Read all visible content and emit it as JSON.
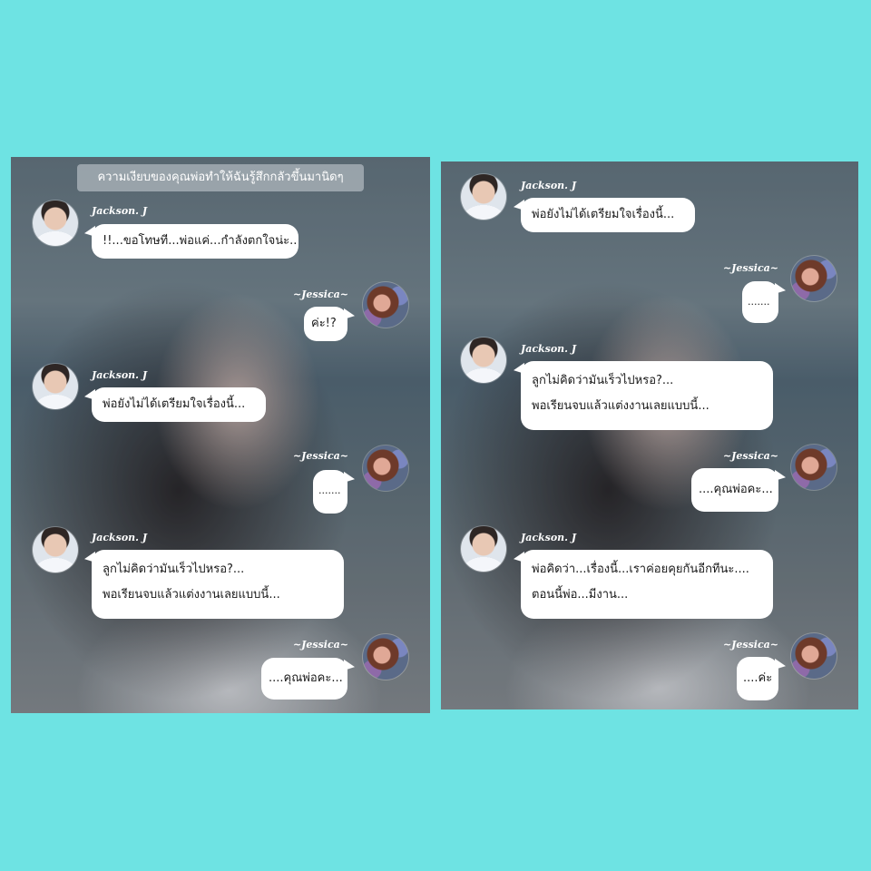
{
  "panels": [
    {
      "caption": "ความเงียบของคุณพ่อทำให้ฉันรู้สึกกลัวขึ้นมานิดๆ",
      "messages": [
        {
          "sender": "Jackson. J",
          "side": "left",
          "lines": [
            "!!...ขอโทษที...พ่อแค่...กำลังตกใจน่ะ.."
          ]
        },
        {
          "sender": "~Jessica~",
          "side": "right",
          "lines": [
            "ค่ะ!?"
          ]
        },
        {
          "sender": "Jackson. J",
          "side": "left",
          "lines": [
            "พ่อยังไม่ได้เตรียมใจเรื่องนี้..."
          ]
        },
        {
          "sender": "~Jessica~",
          "side": "right",
          "lines": [
            "......."
          ]
        },
        {
          "sender": "Jackson. J",
          "side": "left",
          "lines": [
            "ลูกไม่คิดว่ามันเร็วไปหรอ?...",
            "พอเรียนจบแล้วแต่งงานเลยแบบนี้..."
          ]
        },
        {
          "sender": "~Jessica~",
          "side": "right",
          "lines": [
            "....คุณพ่อคะ..."
          ]
        }
      ]
    },
    {
      "caption": "",
      "messages": [
        {
          "sender": "Jackson. J",
          "side": "left",
          "lines": [
            "พ่อยังไม่ได้เตรียมใจเรื่องนี้..."
          ]
        },
        {
          "sender": "~Jessica~",
          "side": "right",
          "lines": [
            "......."
          ]
        },
        {
          "sender": "Jackson. J",
          "side": "left",
          "lines": [
            "ลูกไม่คิดว่ามันเร็วไปหรอ?...",
            "พอเรียนจบแล้วแต่งงานเลยแบบนี้..."
          ]
        },
        {
          "sender": "~Jessica~",
          "side": "right",
          "lines": [
            "....คุณพ่อคะ..."
          ]
        },
        {
          "sender": "Jackson. J",
          "side": "left",
          "lines": [
            "พ่อคิดว่า...เรื่องนี้...เราค่อยคุยกันอีกทีนะ....",
            "ตอนนี้พ่อ...มีงาน..."
          ]
        },
        {
          "sender": "~Jessica~",
          "side": "right",
          "lines": [
            "....ค่ะ"
          ]
        }
      ]
    }
  ]
}
